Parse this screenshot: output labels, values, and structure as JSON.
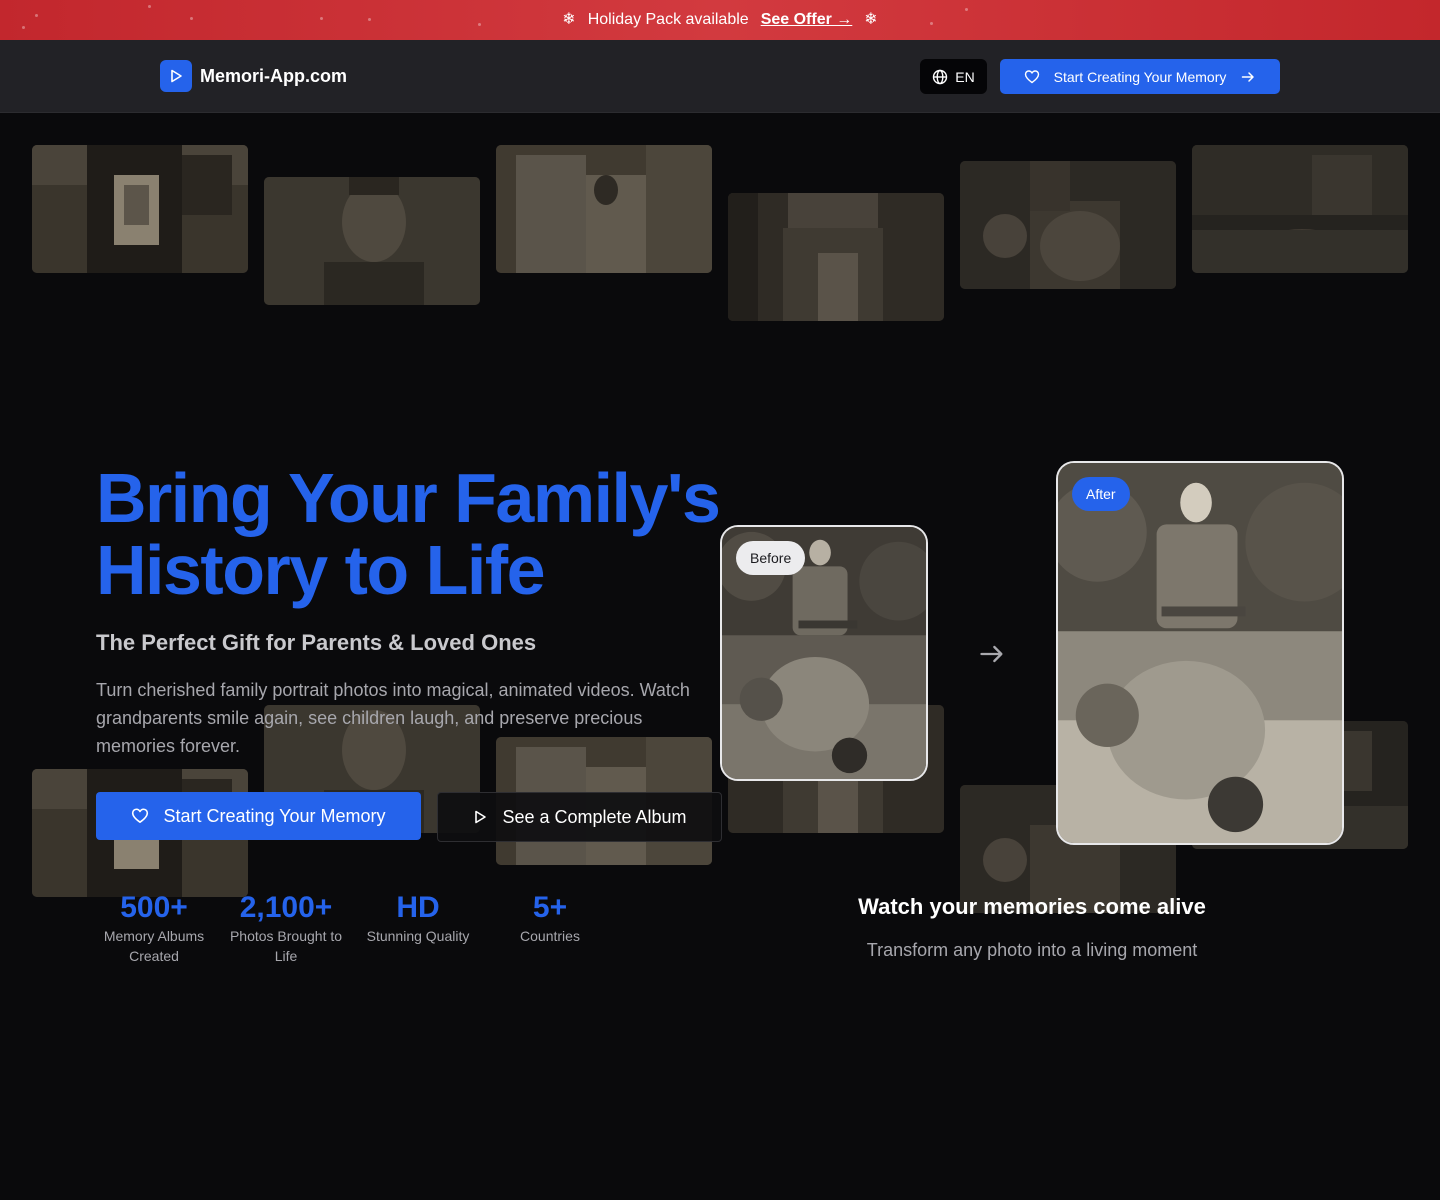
{
  "promo": {
    "text": "Holiday Pack available",
    "offer_label": "See Offer →",
    "icon": "snowflake-icon"
  },
  "header": {
    "brand_name": "Memori-App.com",
    "brand_icon": "play-icon",
    "lang_label": "EN",
    "lang_icon": "globe-icon",
    "cta_label": "Start Creating Your Memory",
    "cta_icons": [
      "heart-icon",
      "arrow-right-icon"
    ]
  },
  "hero": {
    "title_line1": "Bring Your Family's",
    "title_line2": "History to Life",
    "subtitle": "The Perfect Gift for Parents & Loved Ones",
    "description": "Turn cherished family portrait photos into magical, animated videos. Watch grandparents smile again, see children laugh, and preserve precious memories forever.",
    "primary_label": "Start Creating Your Memory",
    "secondary_label": "See a Complete Album"
  },
  "stats": [
    {
      "value": "500+",
      "label": "Memory Albums Created"
    },
    {
      "value": "2,100+",
      "label": "Photos Brought to Life"
    },
    {
      "value": "HD",
      "label": "Stunning Quality"
    },
    {
      "value": "5+",
      "label": "Countries"
    }
  ],
  "comparison": {
    "before_label": "Before",
    "after_label": "After",
    "title": "Watch your memories come alive",
    "subtitle": "Transform any photo into a living moment"
  },
  "colors": {
    "accent": "#2563eb",
    "banner": "#c9282e",
    "background": "#0a0a0c",
    "header": "#222226"
  }
}
